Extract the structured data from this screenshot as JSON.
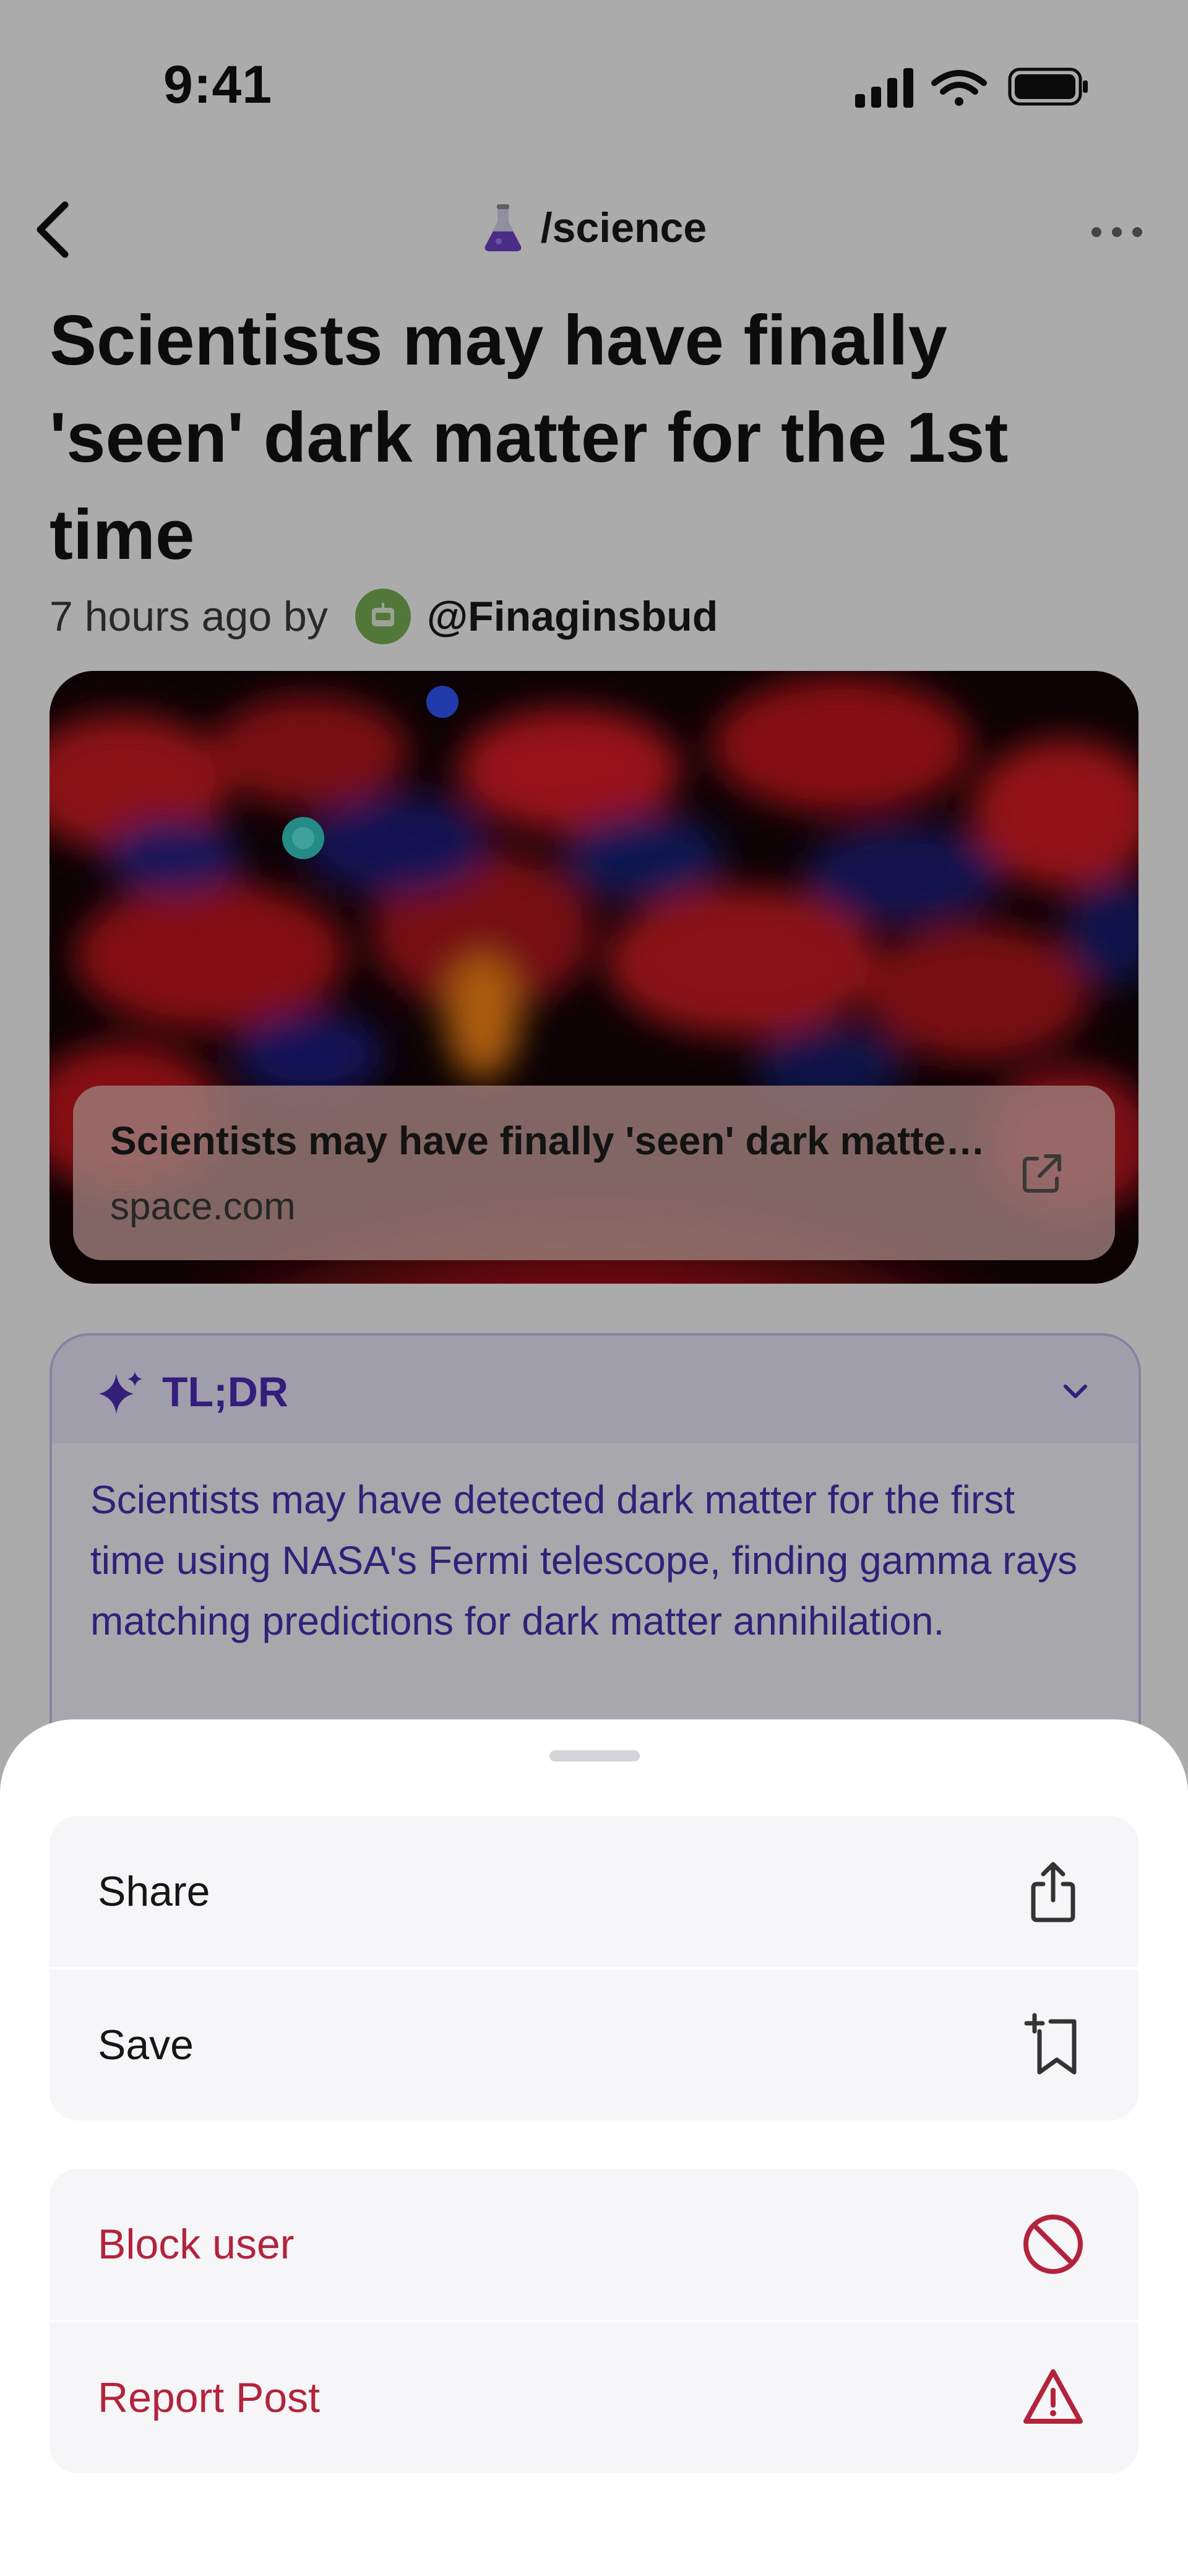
{
  "status": {
    "time": "9:41"
  },
  "nav": {
    "community": "/science"
  },
  "post": {
    "title": "Scientists may have finally 'seen' dark matter for the 1st time",
    "time_ago": "7 hours ago by",
    "author": "@Finaginsbud"
  },
  "link": {
    "title": "Scientists may have finally 'seen' dark matter for the 1st time",
    "domain": "space.com"
  },
  "tldr": {
    "label": "TL;DR",
    "text": "Scientists may have detected dark matter for the first time using NASA's Fermi telescope, finding gamma rays matching predictions for dark matter annihilation."
  },
  "sheet": {
    "items": [
      {
        "label": "Share",
        "icon": "share-icon"
      },
      {
        "label": "Save",
        "icon": "bookmark-add-icon"
      },
      {
        "label": "Block user",
        "icon": "block-icon"
      },
      {
        "label": "Report Post",
        "icon": "warning-icon"
      }
    ]
  },
  "colors": {
    "accent_purple": "#4d2fb8",
    "danger": "#b3243c",
    "sheet_row_bg": "#f6f6f9",
    "scrim": "rgba(0,0,0,0.33)"
  }
}
